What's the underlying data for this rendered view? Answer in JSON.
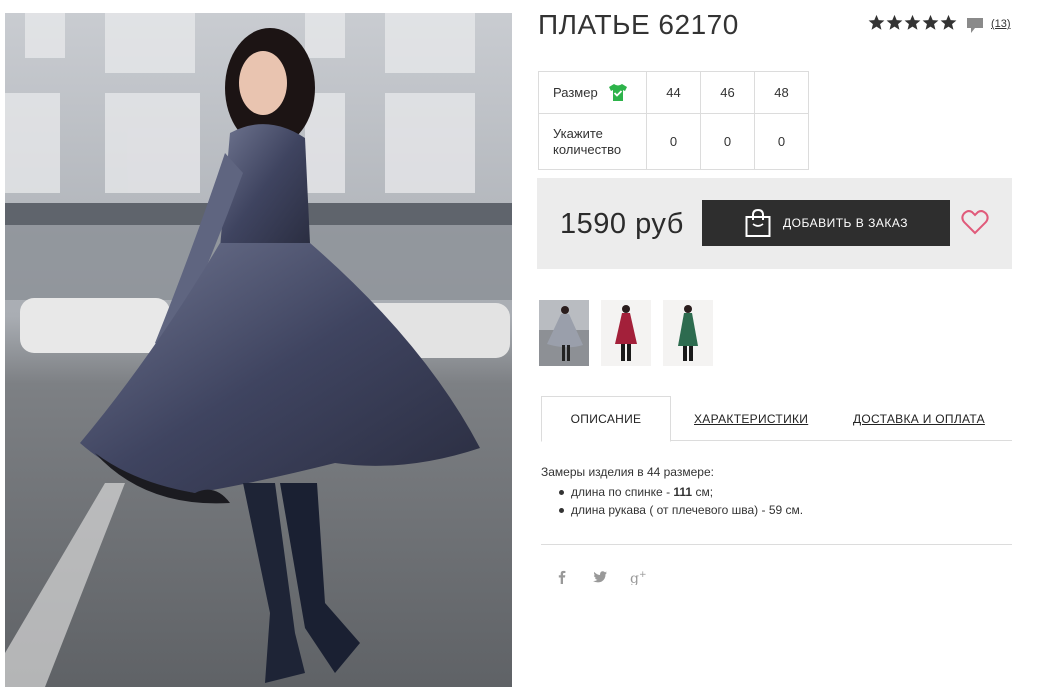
{
  "product": {
    "title": "ПЛАТЬЕ 62170",
    "rating": 5,
    "reviews_label": "(13)"
  },
  "sizes": {
    "size_label": "Размер",
    "quantity_label": "Укажите количество",
    "columns": [
      "44",
      "46",
      "48"
    ],
    "quantities": [
      "0",
      "0",
      "0"
    ]
  },
  "purchase": {
    "price": "1590 руб",
    "add_label": "ДОБАВИТЬ В ЗАКАЗ"
  },
  "tabs": [
    {
      "label": "ОПИСАНИЕ",
      "active": true
    },
    {
      "label": "ХАРАКТЕРИСТИКИ",
      "active": false
    },
    {
      "label": "ДОСТАВКА И ОПЛАТА",
      "active": false
    }
  ],
  "description": {
    "intro": "Замеры изделия в 44 размере:",
    "item1_prefix": "длина по спинке - ",
    "item1_value": "111",
    "item1_suffix": " см;",
    "item2": "длина рукава ( от плечевого шва) - 59 см."
  },
  "social": [
    "facebook-icon",
    "twitter-icon",
    "google-plus-icon"
  ],
  "colors": {
    "accent_dark": "#2e2e2e",
    "price_bg": "#ececec",
    "heart": "#e05a7a",
    "check_green": "#2db34a",
    "thumb_colors": [
      "#9a9fab",
      "#a3203a",
      "#2d6b4f"
    ]
  }
}
